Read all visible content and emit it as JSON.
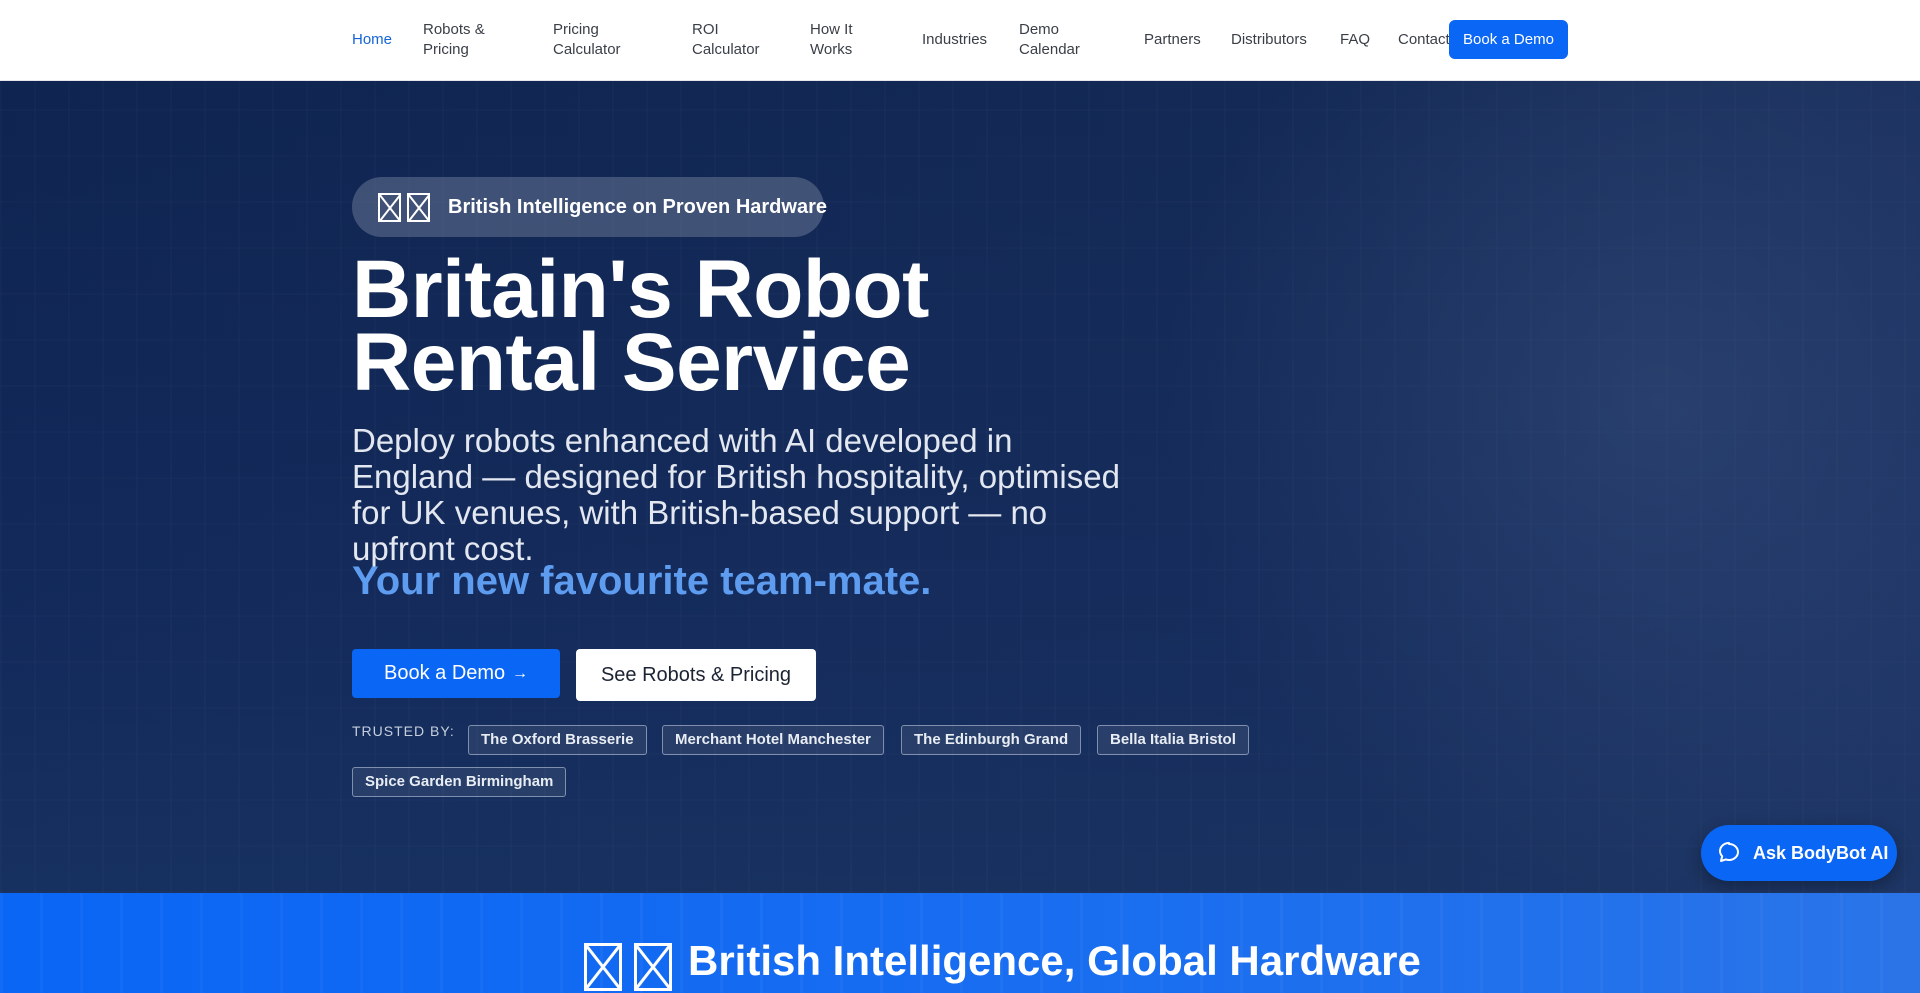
{
  "nav": {
    "items": [
      {
        "label": "Home",
        "active": true
      },
      {
        "label": "Robots & Pricing"
      },
      {
        "label": "Pricing Calculator"
      },
      {
        "label": "ROI Calculator"
      },
      {
        "label": "How It Works"
      },
      {
        "label": "Industries"
      },
      {
        "label": "Demo Calendar"
      },
      {
        "label": "Partners"
      },
      {
        "label": "Distributors"
      },
      {
        "label": "FAQ"
      },
      {
        "label": "Contact"
      }
    ],
    "cta_label": "Book a Demo"
  },
  "hero": {
    "badge_text": "British Intelligence on Proven Hardware",
    "badge_icon": "uk-flag-icon",
    "title": "Britain's Robot Rental Service",
    "subtitle": "Deploy robots enhanced with AI developed in England — designed for British hospitality, optimised for UK venues, with British-based support — no upfront cost.",
    "tagline": "Your new favourite team-mate.",
    "primary_button": "Book a Demo",
    "primary_button_arrow": "→",
    "secondary_button": "See Robots & Pricing",
    "trusted_label": "TRUSTED BY:",
    "trusted_by": [
      "The Oxford Brasserie",
      "Merchant Hotel Manchester",
      "The Edinburgh Grand",
      "Bella Italia Bristol",
      "Spice Garden Birmingham"
    ]
  },
  "chat_widget": {
    "label": "Ask BodyBot AI",
    "icon": "chat-bubble-icon"
  },
  "band": {
    "title": "British Intelligence, Global Hardware",
    "icon": "uk-flag-icon"
  },
  "colors": {
    "accent": "#0a66f5",
    "hero_bg": "#12295a",
    "tagline": "#5e9cf0",
    "nav_active": "#1565d8"
  }
}
